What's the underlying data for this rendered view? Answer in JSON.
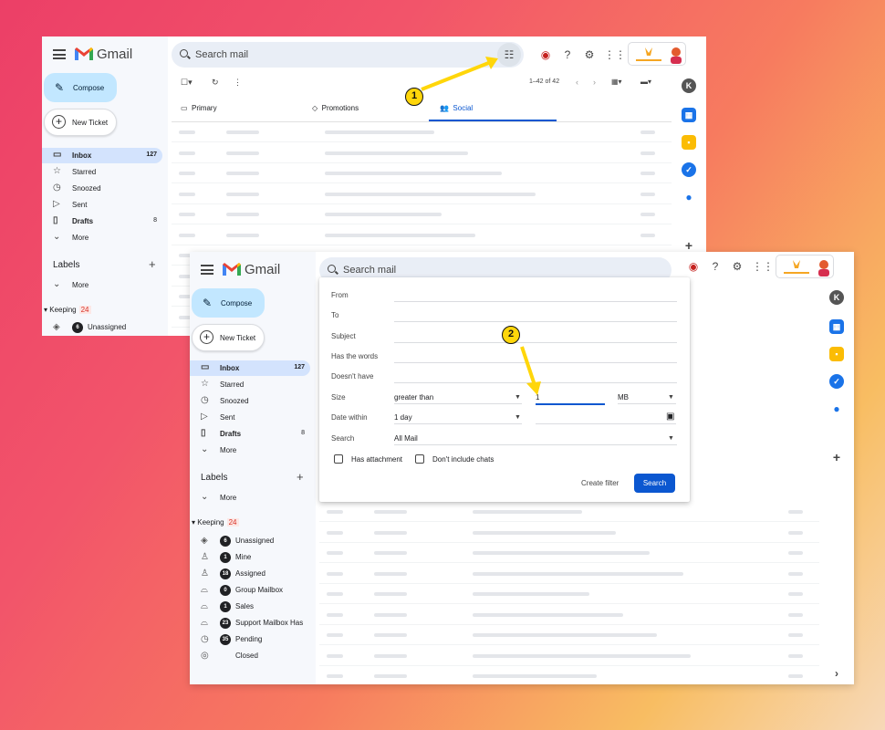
{
  "app": {
    "brand": "Gmail",
    "search_placeholder": "Search mail"
  },
  "sidebar": {
    "compose": "Compose",
    "new_ticket": "New Ticket",
    "items": [
      {
        "label": "Inbox",
        "count": "127",
        "icon": "inbox-icon"
      },
      {
        "label": "Starred",
        "icon": "star-icon"
      },
      {
        "label": "Snoozed",
        "icon": "clock-icon"
      },
      {
        "label": "Sent",
        "icon": "send-icon"
      },
      {
        "label": "Drafts",
        "count": "8",
        "icon": "draft-icon"
      },
      {
        "label": "More",
        "icon": "chevron-down-icon"
      }
    ],
    "labels_heading": "Labels",
    "labels_more": "More",
    "keeping": {
      "label": "Keeping",
      "count": "24"
    },
    "keeping_items": [
      {
        "count": "6",
        "label": "Unassigned"
      },
      {
        "count": "1",
        "label": "Mine"
      },
      {
        "count": "18",
        "label": "Assigned"
      },
      {
        "count": "0",
        "label": "Group Mailbox"
      },
      {
        "count": "1",
        "label": "Sales"
      },
      {
        "count": "23",
        "label": "Support Mailbox Has"
      },
      {
        "count": "35",
        "label": "Pending"
      },
      {
        "count": "",
        "label": "Closed"
      }
    ]
  },
  "toolbar": {
    "pagination": "1–42 of 42"
  },
  "tabs": [
    {
      "label": "Primary"
    },
    {
      "label": "Promotions"
    },
    {
      "label": "Social"
    }
  ],
  "search_panel": {
    "from_label": "From",
    "to_label": "To",
    "subject_label": "Subject",
    "has_words_label": "Has the words",
    "doesnt_have_label": "Doesn't have",
    "size_label": "Size",
    "size_operator": "greater than",
    "size_value": "1",
    "size_unit": "MB",
    "date_within_label": "Date within",
    "date_within_value": "1 day",
    "search_label": "Search",
    "search_value": "All Mail",
    "has_attachment": "Has attachment",
    "dont_include_chats": "Don't include chats",
    "create_filter": "Create filter",
    "search_button": "Search"
  },
  "steps": {
    "one": "1",
    "two": "2"
  },
  "colors": {
    "compose_bg": "#c2e7ff",
    "active_nav": "#d3e3fd",
    "search_button": "#0b57d0",
    "step_badge": "#ffd60a",
    "social_tab": "#0b57d0"
  }
}
